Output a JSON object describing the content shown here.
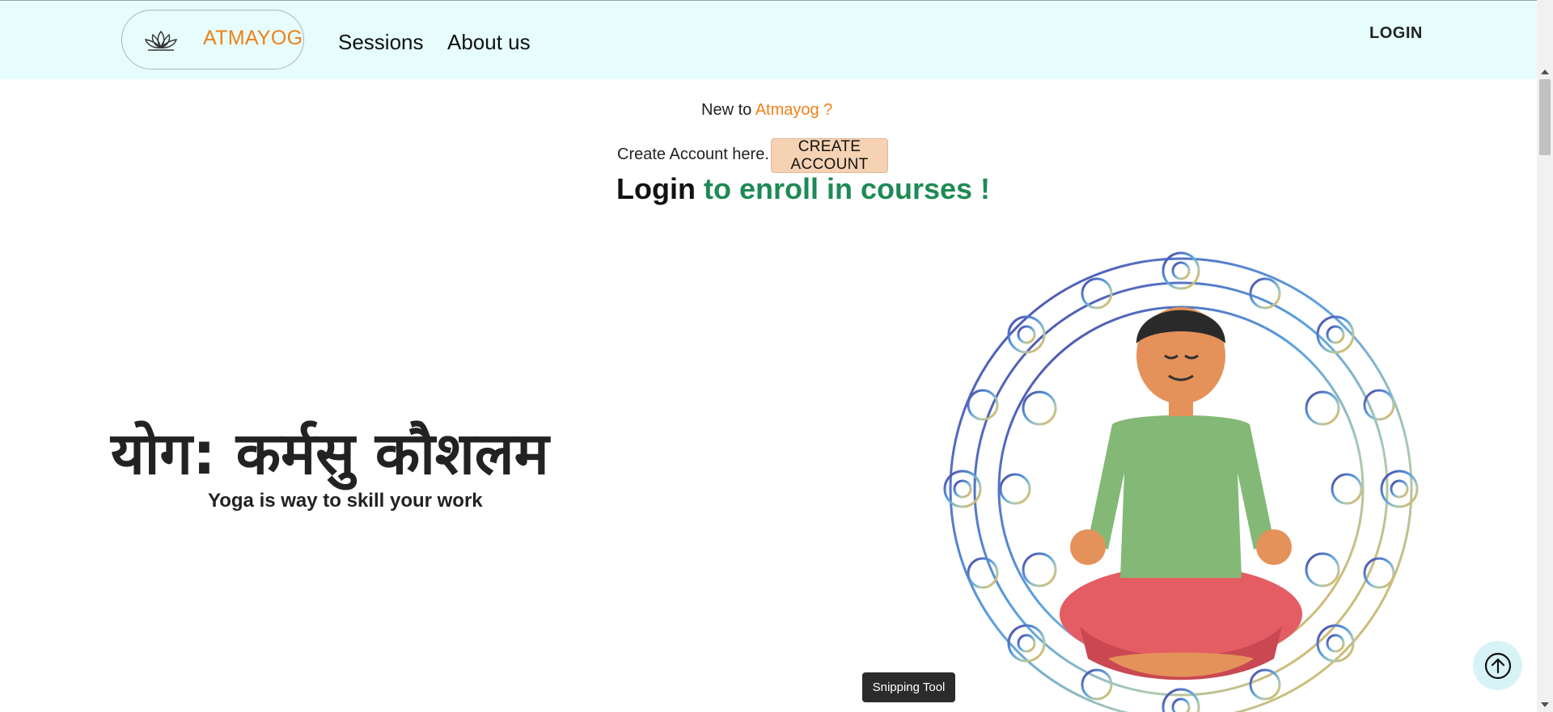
{
  "nav": {
    "brand": "ATMAYOG",
    "links": [
      {
        "label": "Sessions"
      },
      {
        "label": "About us"
      }
    ],
    "login": "LOGIN"
  },
  "signup": {
    "new_to_prefix": "New to ",
    "new_to_brand": "Atmayog ?",
    "create_text": "Create Account here.",
    "create_button": "CREATE ACCOUNT"
  },
  "login_heading": {
    "prefix": "Login ",
    "highlight": "to enroll in courses !"
  },
  "hero": {
    "sanskrit": "योग: कर्मसु कौशलम",
    "subtitle": "Yoga is way to skill your work"
  },
  "tooltip": "Snipping Tool",
  "colors": {
    "navbar_bg": "#e6fdfb",
    "brand_orange": "#f08016",
    "heading_green": "#1e8a55",
    "create_button_bg": "#f5d2b3"
  },
  "icons": [
    "lotus-logo-icon",
    "arrow-up-circle-icon"
  ]
}
